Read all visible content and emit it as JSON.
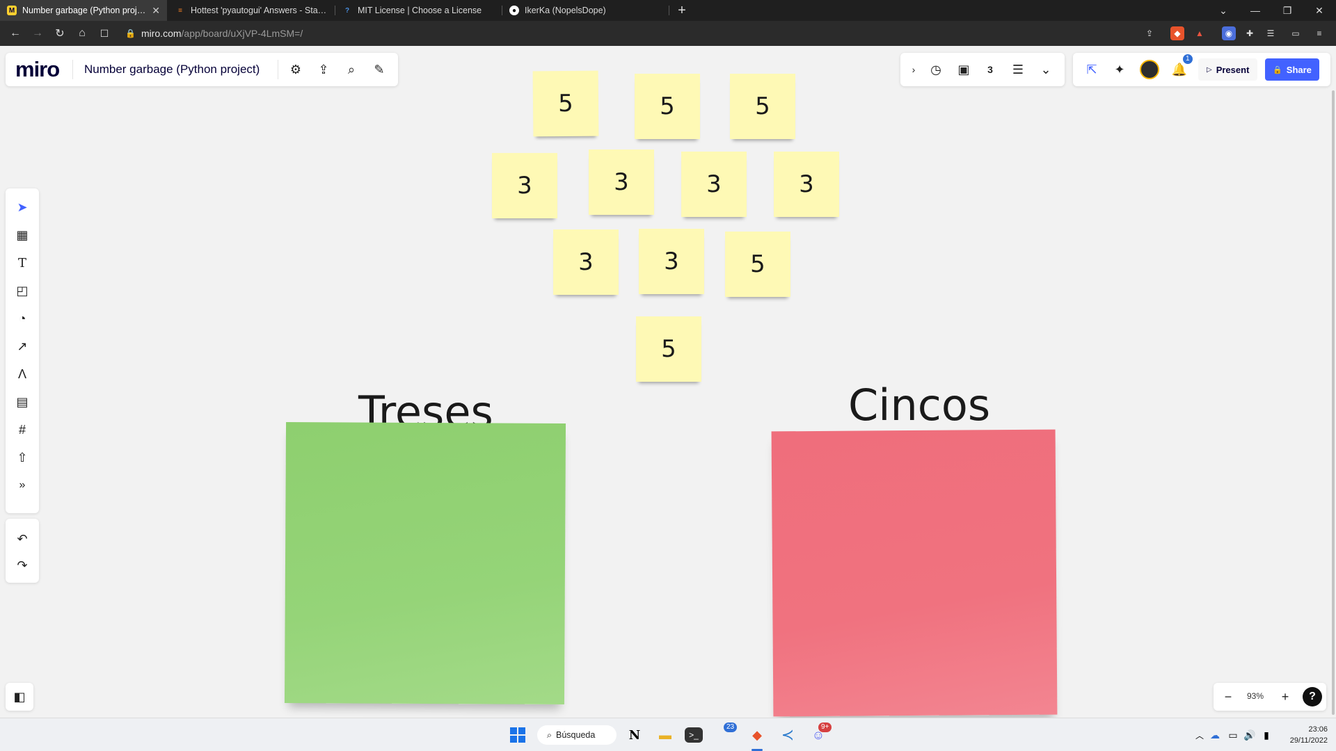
{
  "browser": {
    "tabs": [
      {
        "title": "Number garbage (Python project)",
        "active": true,
        "favicon": "miro-icon"
      },
      {
        "title": "Hottest 'pyautogui' Answers - Stack O",
        "active": false,
        "favicon": "stackoverflow-icon"
      },
      {
        "title": "MIT License | Choose a License",
        "active": false,
        "favicon": "question-icon"
      },
      {
        "title": "IkerKa (NopelsDope)",
        "active": false,
        "favicon": "github-icon"
      }
    ],
    "url_domain": "miro.com",
    "url_path": "/app/board/uXjVP-4LmSM=/"
  },
  "miro": {
    "logo": "miro",
    "board_title": "Number garbage (Python project)",
    "present_label": "Present",
    "share_label": "Share",
    "notification_count": "1",
    "zoom": "93%",
    "help": "?"
  },
  "board": {
    "stickies": [
      {
        "value": "5"
      },
      {
        "value": "5"
      },
      {
        "value": "5"
      },
      {
        "value": "3"
      },
      {
        "value": "3"
      },
      {
        "value": "3"
      },
      {
        "value": "3"
      },
      {
        "value": "3"
      },
      {
        "value": "3"
      },
      {
        "value": "5"
      },
      {
        "value": "5"
      }
    ],
    "bins": [
      {
        "title": "Treses",
        "color": "#93d275"
      },
      {
        "title": "Cincos",
        "color": "#f0707f"
      }
    ]
  },
  "taskbar": {
    "search_label": "Búsqueda",
    "time": "23:06",
    "date": "29/11/2022",
    "widget_badge": "23",
    "discord_badge": "9+"
  },
  "colors": {
    "accent": "#4262ff",
    "sticky_yellow": "#fef9b5"
  }
}
